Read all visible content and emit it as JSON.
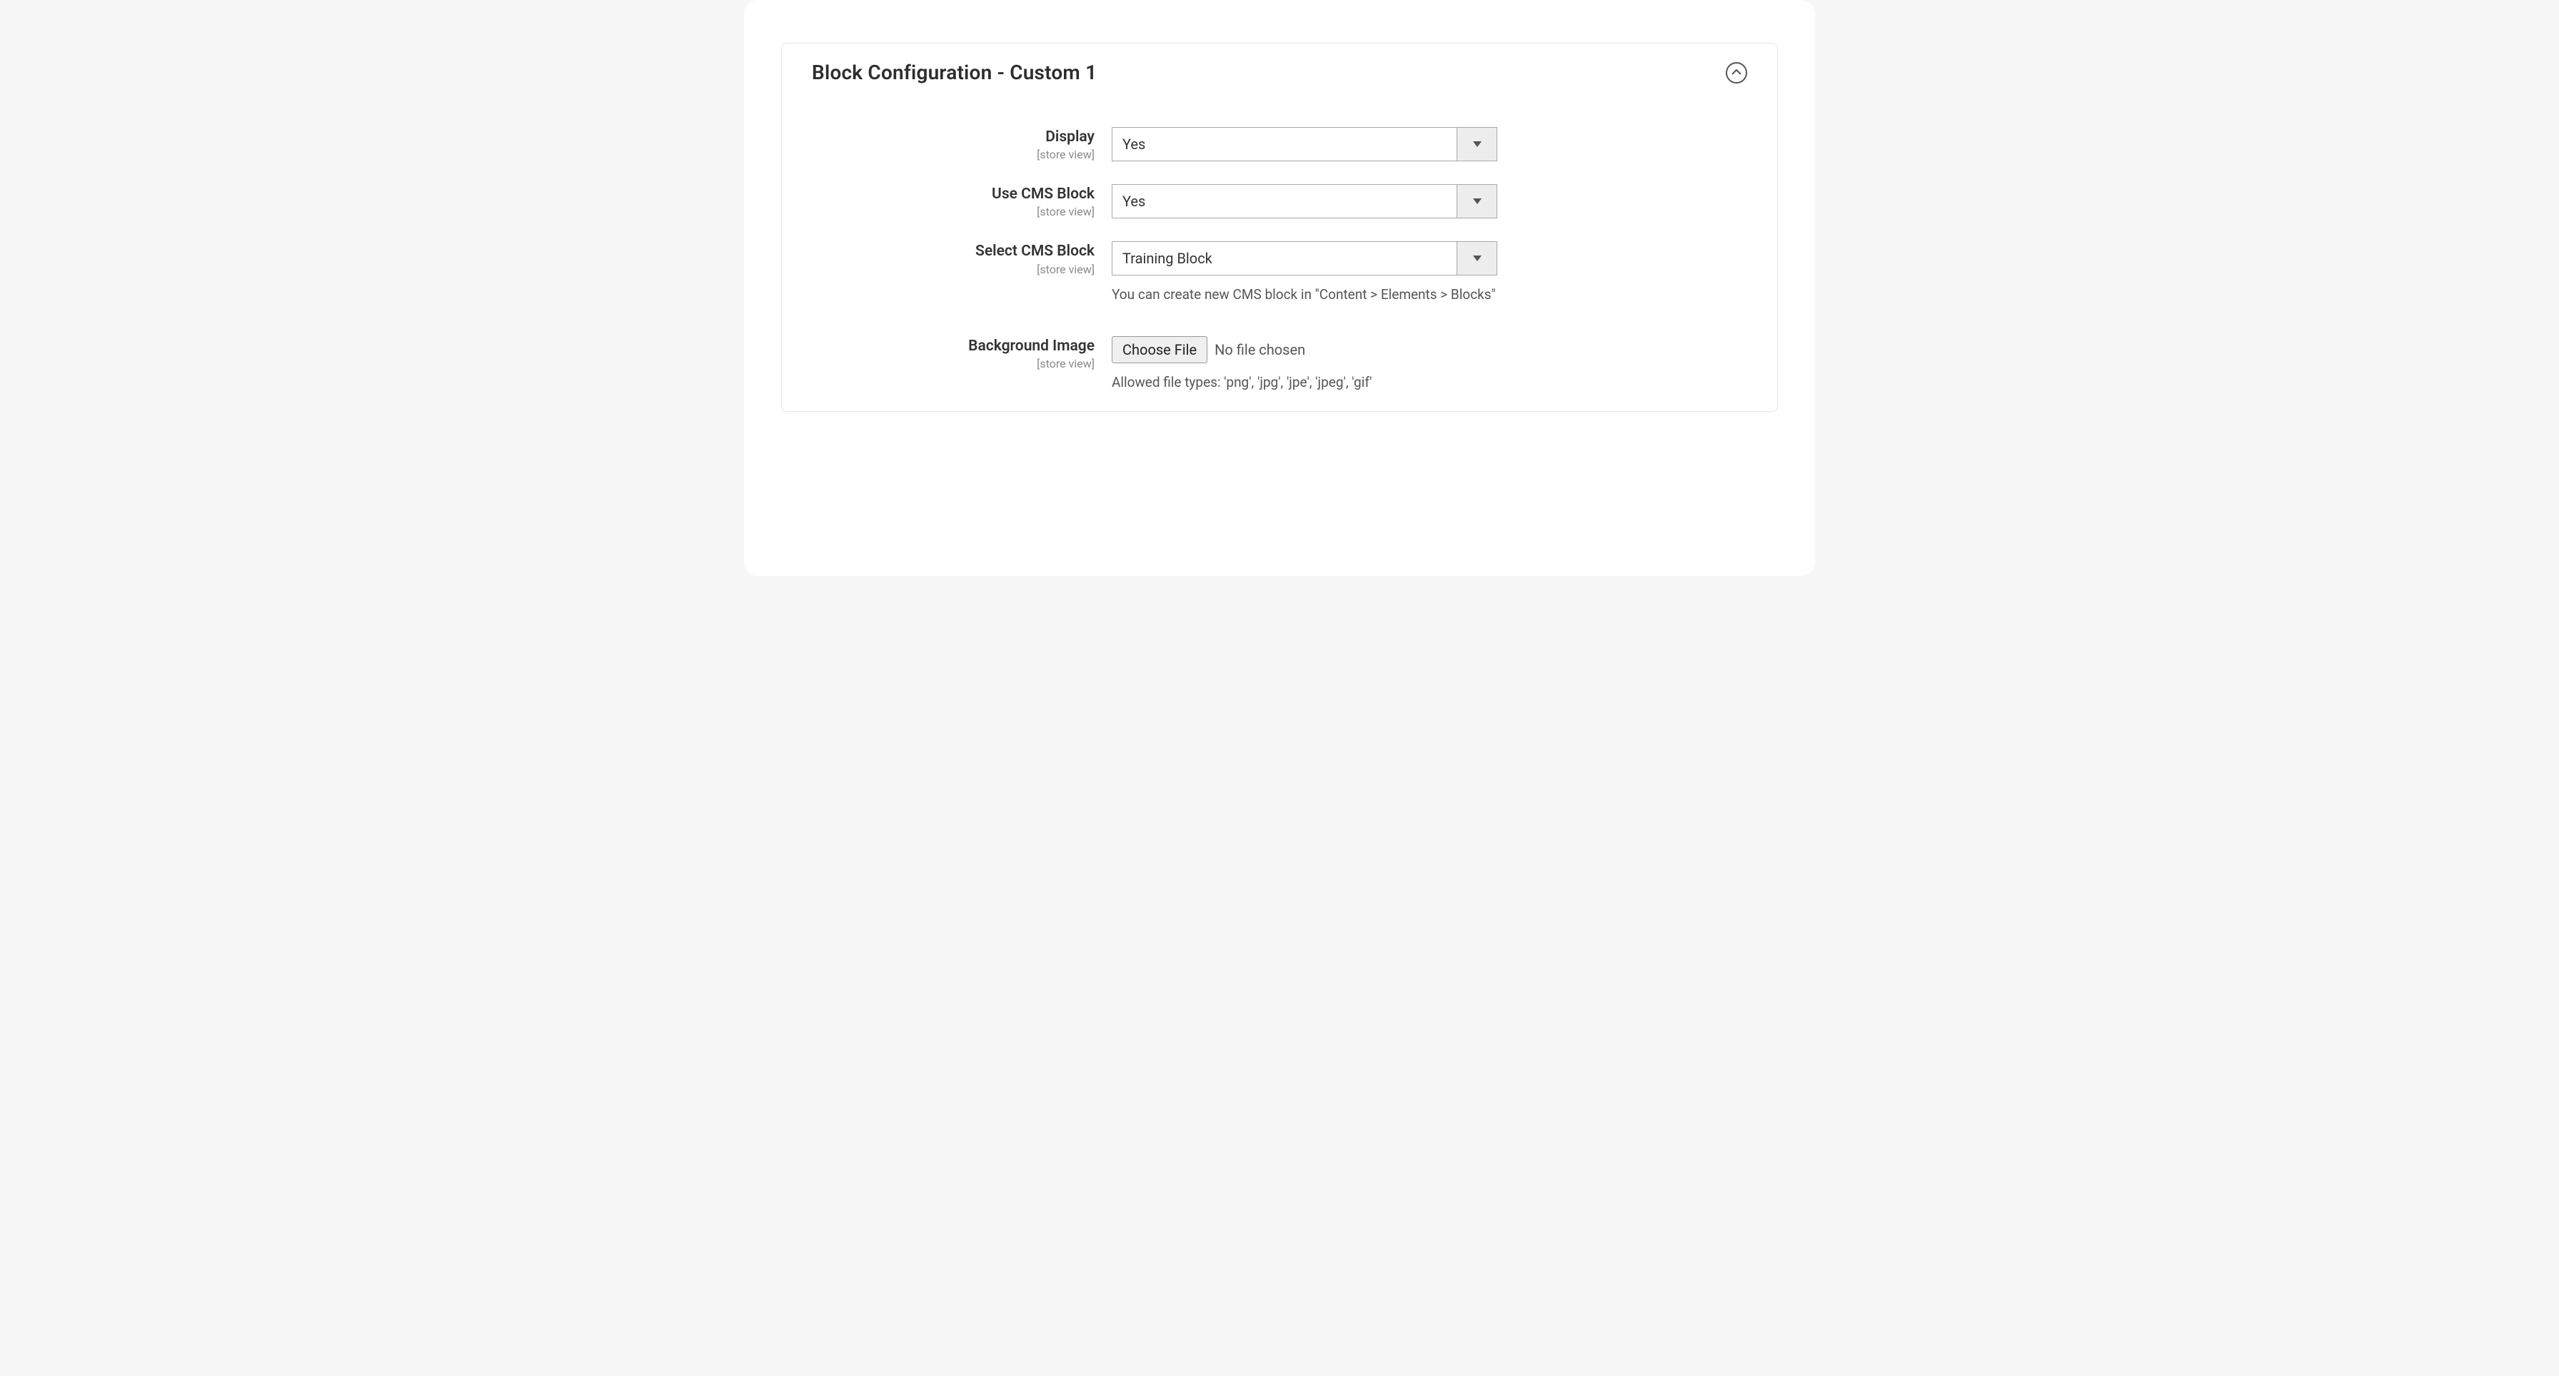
{
  "panel": {
    "title": "Block Configuration - Custom 1"
  },
  "fields": {
    "display": {
      "label": "Display",
      "scope": "[store view]",
      "value": "Yes"
    },
    "use_cms_block": {
      "label": "Use CMS Block",
      "scope": "[store view]",
      "value": "Yes"
    },
    "select_cms_block": {
      "label": "Select CMS Block",
      "scope": "[store view]",
      "value": "Training Block",
      "help": "You can create new CMS block in \"Content > Elements > Blocks\""
    },
    "background_image": {
      "label": "Background Image",
      "scope": "[store view]",
      "button": "Choose File",
      "status": "No file chosen",
      "help": "Allowed file types: 'png', 'jpg', 'jpe', 'jpeg', 'gif'"
    }
  }
}
